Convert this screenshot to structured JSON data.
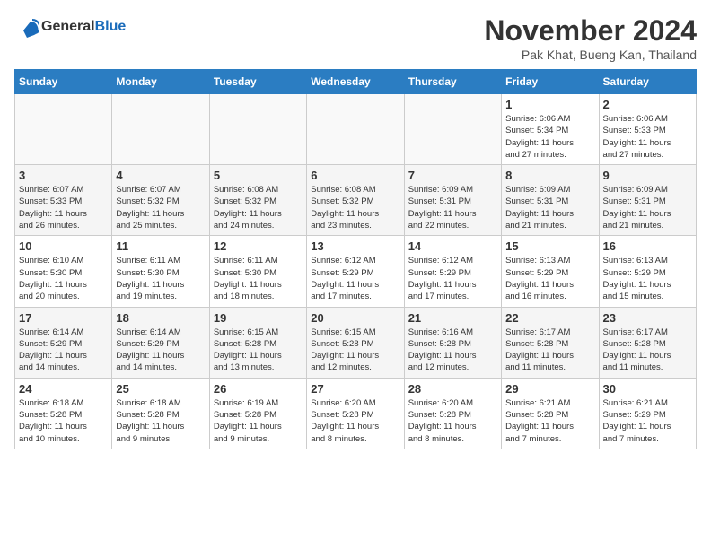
{
  "header": {
    "logo_general": "General",
    "logo_blue": "Blue",
    "month": "November 2024",
    "location": "Pak Khat, Bueng Kan, Thailand"
  },
  "weekdays": [
    "Sunday",
    "Monday",
    "Tuesday",
    "Wednesday",
    "Thursday",
    "Friday",
    "Saturday"
  ],
  "weeks": [
    {
      "shaded": false,
      "days": [
        {
          "num": "",
          "info": ""
        },
        {
          "num": "",
          "info": ""
        },
        {
          "num": "",
          "info": ""
        },
        {
          "num": "",
          "info": ""
        },
        {
          "num": "",
          "info": ""
        },
        {
          "num": "1",
          "info": "Sunrise: 6:06 AM\nSunset: 5:34 PM\nDaylight: 11 hours\nand 27 minutes."
        },
        {
          "num": "2",
          "info": "Sunrise: 6:06 AM\nSunset: 5:33 PM\nDaylight: 11 hours\nand 27 minutes."
        }
      ]
    },
    {
      "shaded": true,
      "days": [
        {
          "num": "3",
          "info": "Sunrise: 6:07 AM\nSunset: 5:33 PM\nDaylight: 11 hours\nand 26 minutes."
        },
        {
          "num": "4",
          "info": "Sunrise: 6:07 AM\nSunset: 5:32 PM\nDaylight: 11 hours\nand 25 minutes."
        },
        {
          "num": "5",
          "info": "Sunrise: 6:08 AM\nSunset: 5:32 PM\nDaylight: 11 hours\nand 24 minutes."
        },
        {
          "num": "6",
          "info": "Sunrise: 6:08 AM\nSunset: 5:32 PM\nDaylight: 11 hours\nand 23 minutes."
        },
        {
          "num": "7",
          "info": "Sunrise: 6:09 AM\nSunset: 5:31 PM\nDaylight: 11 hours\nand 22 minutes."
        },
        {
          "num": "8",
          "info": "Sunrise: 6:09 AM\nSunset: 5:31 PM\nDaylight: 11 hours\nand 21 minutes."
        },
        {
          "num": "9",
          "info": "Sunrise: 6:09 AM\nSunset: 5:31 PM\nDaylight: 11 hours\nand 21 minutes."
        }
      ]
    },
    {
      "shaded": false,
      "days": [
        {
          "num": "10",
          "info": "Sunrise: 6:10 AM\nSunset: 5:30 PM\nDaylight: 11 hours\nand 20 minutes."
        },
        {
          "num": "11",
          "info": "Sunrise: 6:11 AM\nSunset: 5:30 PM\nDaylight: 11 hours\nand 19 minutes."
        },
        {
          "num": "12",
          "info": "Sunrise: 6:11 AM\nSunset: 5:30 PM\nDaylight: 11 hours\nand 18 minutes."
        },
        {
          "num": "13",
          "info": "Sunrise: 6:12 AM\nSunset: 5:29 PM\nDaylight: 11 hours\nand 17 minutes."
        },
        {
          "num": "14",
          "info": "Sunrise: 6:12 AM\nSunset: 5:29 PM\nDaylight: 11 hours\nand 17 minutes."
        },
        {
          "num": "15",
          "info": "Sunrise: 6:13 AM\nSunset: 5:29 PM\nDaylight: 11 hours\nand 16 minutes."
        },
        {
          "num": "16",
          "info": "Sunrise: 6:13 AM\nSunset: 5:29 PM\nDaylight: 11 hours\nand 15 minutes."
        }
      ]
    },
    {
      "shaded": true,
      "days": [
        {
          "num": "17",
          "info": "Sunrise: 6:14 AM\nSunset: 5:29 PM\nDaylight: 11 hours\nand 14 minutes."
        },
        {
          "num": "18",
          "info": "Sunrise: 6:14 AM\nSunset: 5:29 PM\nDaylight: 11 hours\nand 14 minutes."
        },
        {
          "num": "19",
          "info": "Sunrise: 6:15 AM\nSunset: 5:28 PM\nDaylight: 11 hours\nand 13 minutes."
        },
        {
          "num": "20",
          "info": "Sunrise: 6:15 AM\nSunset: 5:28 PM\nDaylight: 11 hours\nand 12 minutes."
        },
        {
          "num": "21",
          "info": "Sunrise: 6:16 AM\nSunset: 5:28 PM\nDaylight: 11 hours\nand 12 minutes."
        },
        {
          "num": "22",
          "info": "Sunrise: 6:17 AM\nSunset: 5:28 PM\nDaylight: 11 hours\nand 11 minutes."
        },
        {
          "num": "23",
          "info": "Sunrise: 6:17 AM\nSunset: 5:28 PM\nDaylight: 11 hours\nand 11 minutes."
        }
      ]
    },
    {
      "shaded": false,
      "days": [
        {
          "num": "24",
          "info": "Sunrise: 6:18 AM\nSunset: 5:28 PM\nDaylight: 11 hours\nand 10 minutes."
        },
        {
          "num": "25",
          "info": "Sunrise: 6:18 AM\nSunset: 5:28 PM\nDaylight: 11 hours\nand 9 minutes."
        },
        {
          "num": "26",
          "info": "Sunrise: 6:19 AM\nSunset: 5:28 PM\nDaylight: 11 hours\nand 9 minutes."
        },
        {
          "num": "27",
          "info": "Sunrise: 6:20 AM\nSunset: 5:28 PM\nDaylight: 11 hours\nand 8 minutes."
        },
        {
          "num": "28",
          "info": "Sunrise: 6:20 AM\nSunset: 5:28 PM\nDaylight: 11 hours\nand 8 minutes."
        },
        {
          "num": "29",
          "info": "Sunrise: 6:21 AM\nSunset: 5:28 PM\nDaylight: 11 hours\nand 7 minutes."
        },
        {
          "num": "30",
          "info": "Sunrise: 6:21 AM\nSunset: 5:29 PM\nDaylight: 11 hours\nand 7 minutes."
        }
      ]
    }
  ]
}
